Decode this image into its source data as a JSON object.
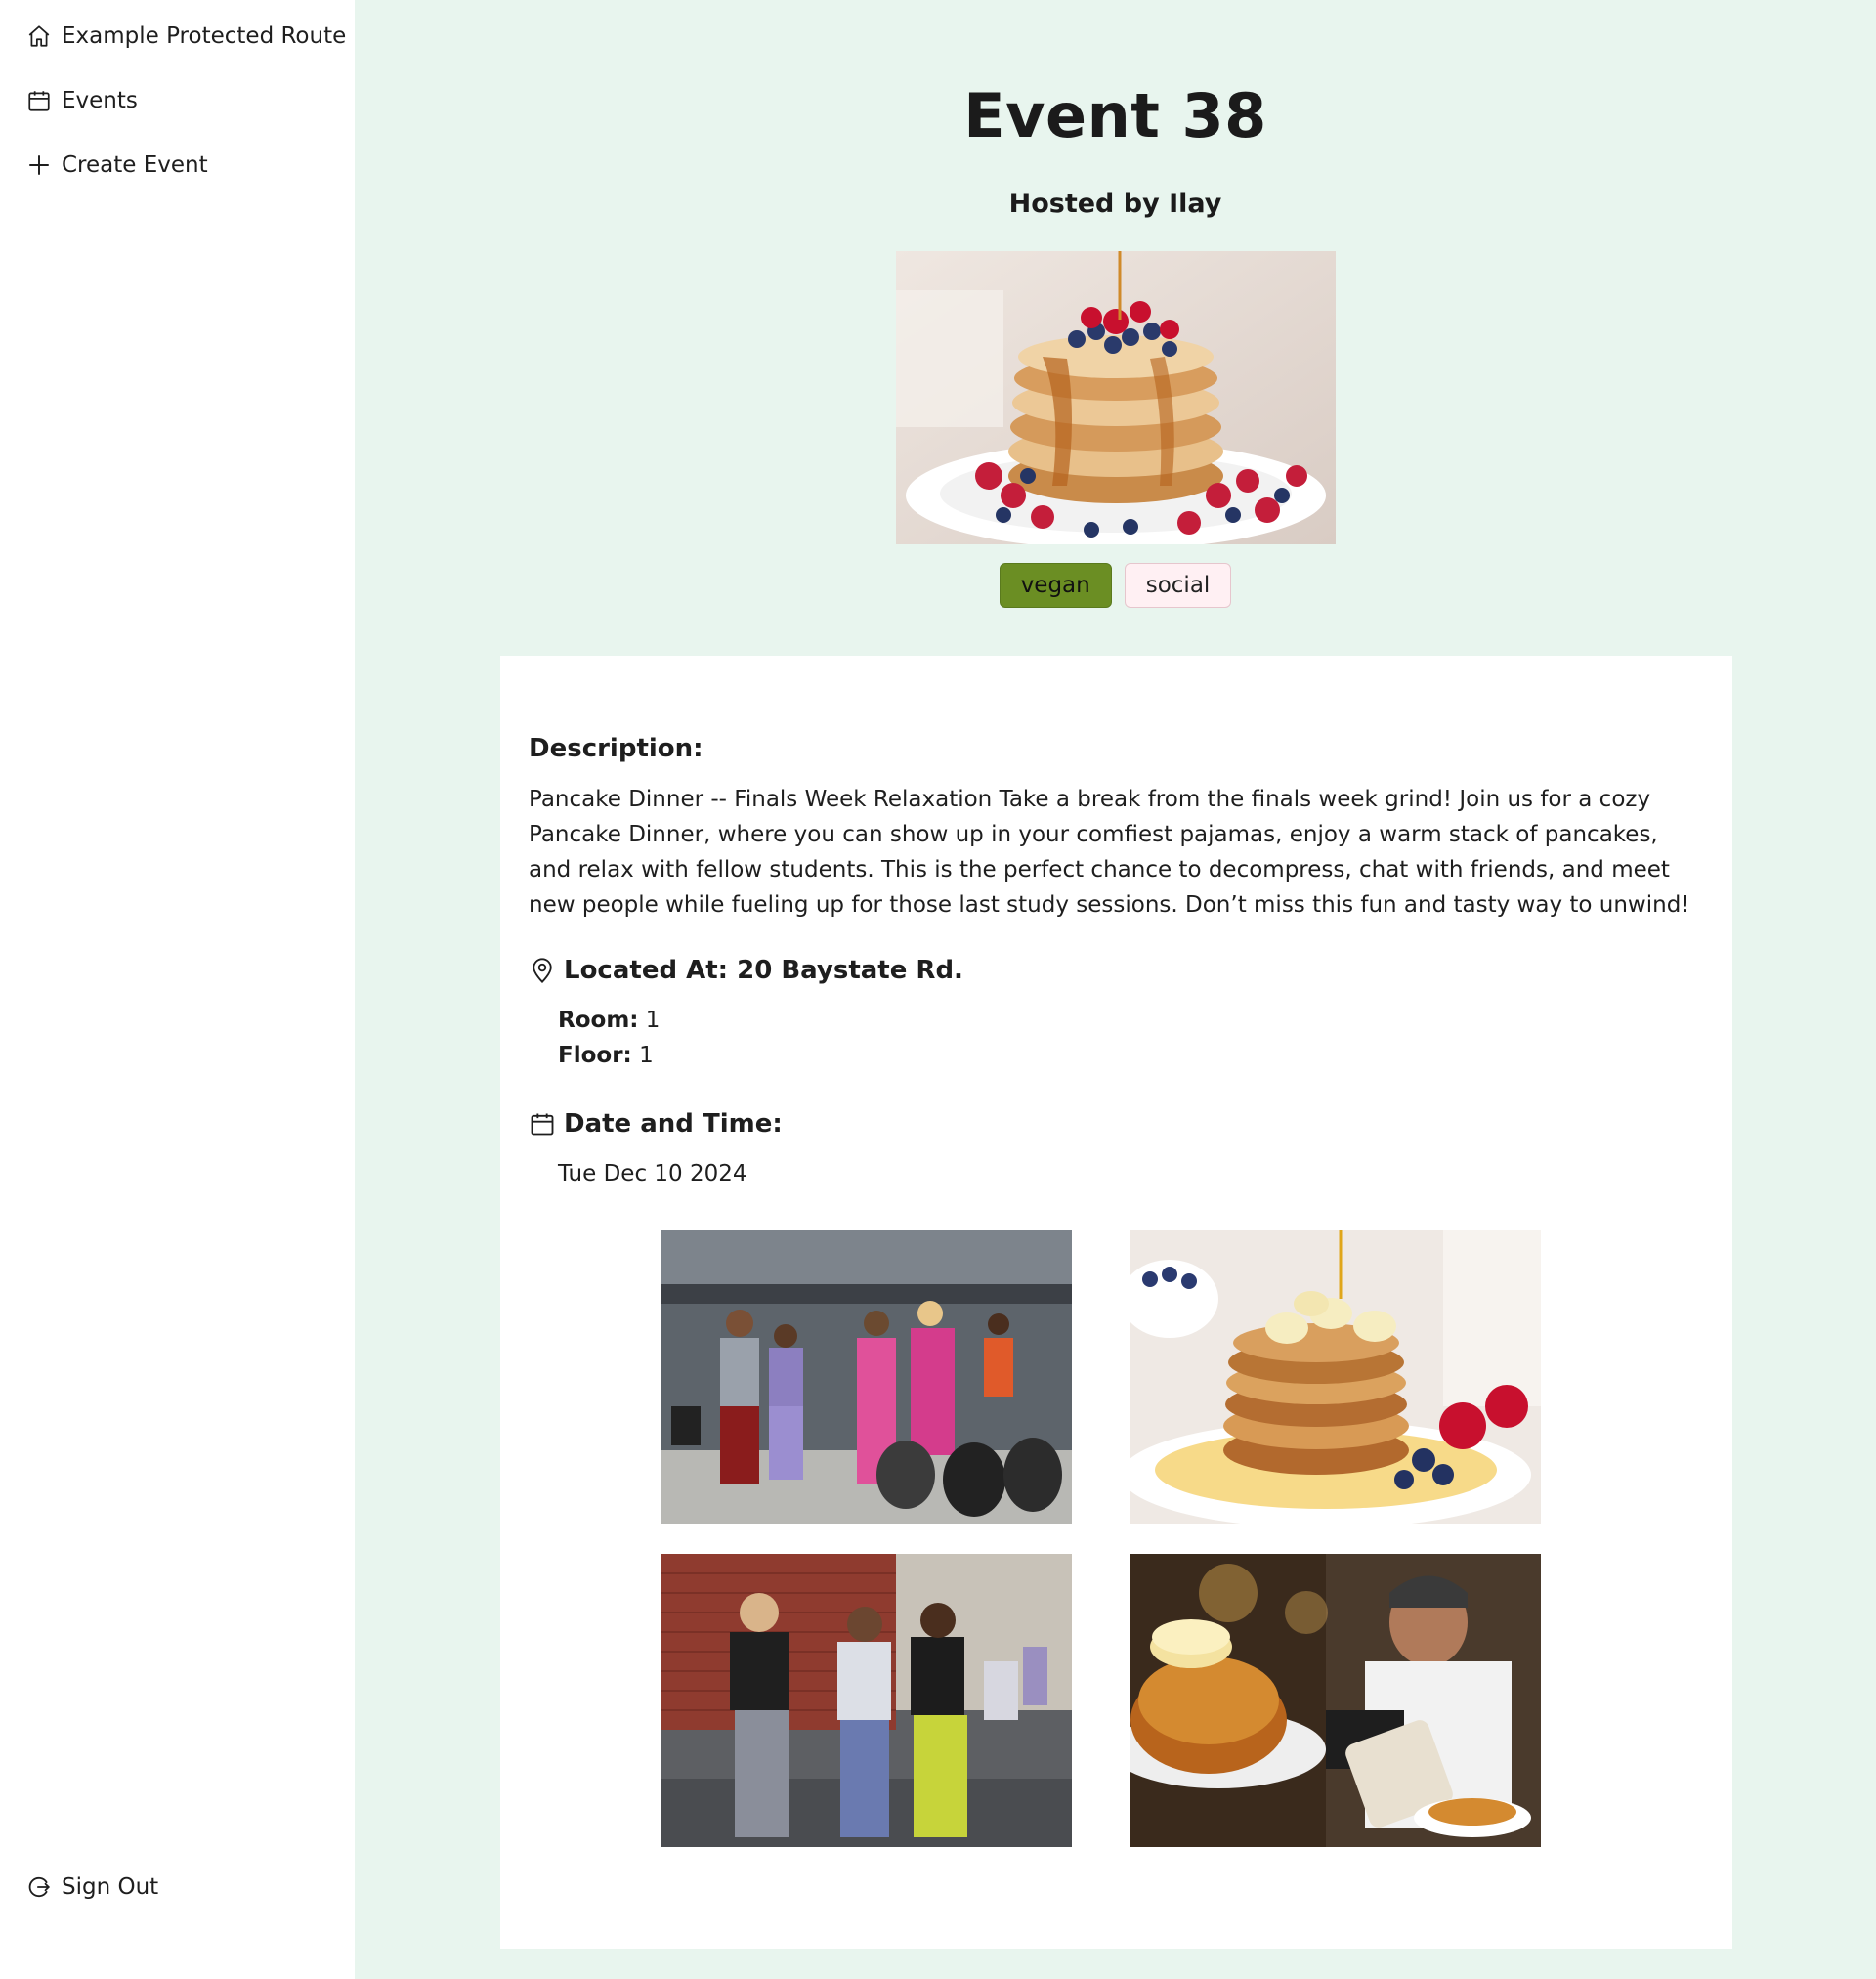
{
  "sidebar": {
    "items": [
      {
        "label": "Example Protected Route",
        "icon": "home-icon"
      },
      {
        "label": "Events",
        "icon": "calendar-icon"
      },
      {
        "label": "Create Event",
        "icon": "plus-icon"
      }
    ],
    "sign_out": {
      "label": "Sign Out",
      "icon": "sign-out-icon"
    }
  },
  "event": {
    "title": "Event 38",
    "hosted_by": "Hosted by Ilay",
    "hero_image": "pancake-stack-with-berries-photo",
    "tags": [
      {
        "label": "vegan",
        "color": "#6b8e23"
      },
      {
        "label": "social",
        "color": "#fff0f3"
      }
    ],
    "description_label": "Description:",
    "description": "Pancake Dinner -- Finals Week Relaxation Take a break from the finals week grind! Join us for a cozy Pancake Dinner, where you can show up in your comfiest pajamas, enjoy a warm stack of pancakes, and relax with fellow students. This is the perfect chance to decompress, chat with friends, and meet new people while fueling up for those last study sessions. Don’t miss this fun and tasty way to unwind!",
    "location_heading": "Located At: 20 Baystate Rd.",
    "room_label": "Room:",
    "room_value": "1",
    "floor_label": "Floor:",
    "floor_value": "1",
    "date_heading": "Date and Time:",
    "date_value": "Tue Dec 10 2024",
    "gallery": [
      "students-in-pajamas-outdoors-photo",
      "pancakes-with-banana-and-berries-photo",
      "students-pajama-pants-photo",
      "chef-making-pancakes-photo"
    ]
  },
  "colors": {
    "page_background": "#e8f5ee",
    "sidebar_background": "#ffffff",
    "card_background": "#ffffff",
    "text": "#1e1e1e"
  }
}
